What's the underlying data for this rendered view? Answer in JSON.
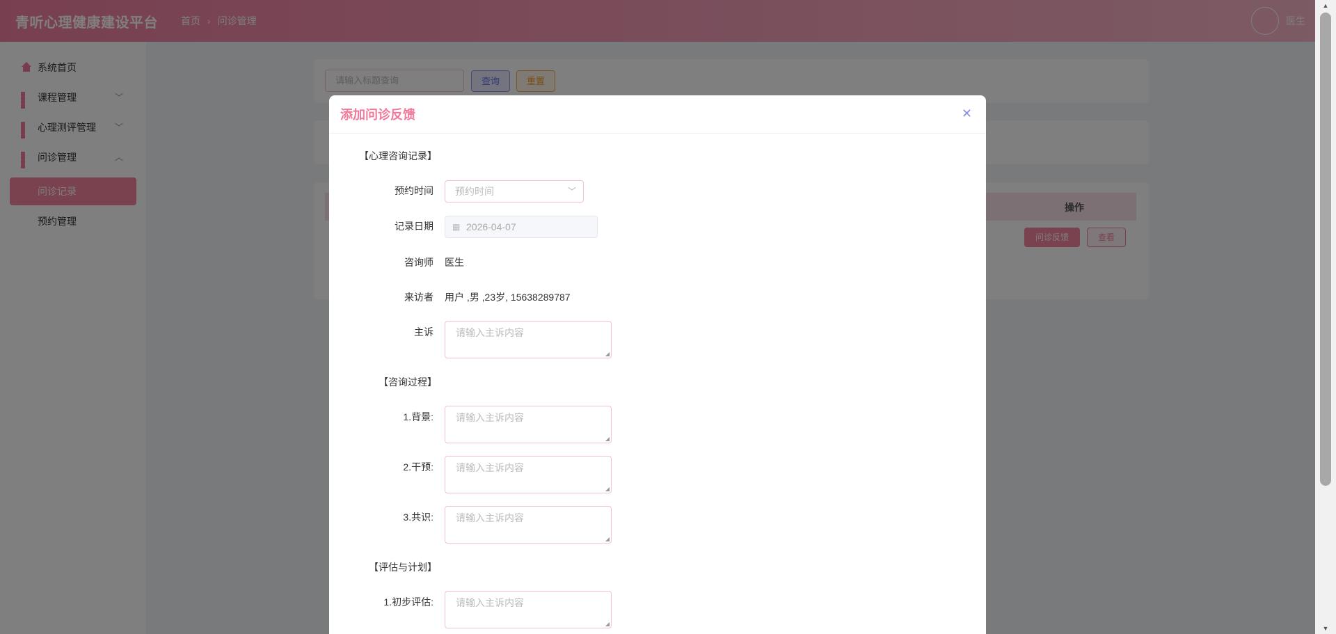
{
  "header": {
    "brand": "青听心理健康建设平台",
    "breadcrumb": [
      "首页",
      "问诊管理"
    ],
    "user_name": "医生"
  },
  "sidebar": {
    "items": [
      {
        "label": "系统首页",
        "icon": "home-icon"
      },
      {
        "label": "课程管理",
        "icon": "grid-icon",
        "chevron": "﹀"
      },
      {
        "label": "心理测评管理",
        "icon": "grid-icon",
        "chevron": "﹀"
      },
      {
        "label": "问诊管理",
        "icon": "grid-icon",
        "chevron": "︿"
      }
    ],
    "sub_items": [
      {
        "label": "问诊记录",
        "active": true
      },
      {
        "label": "预约管理",
        "active": false
      }
    ]
  },
  "main": {
    "search_placeholder": "请输入标题查询",
    "query_label": "查询",
    "reset_label": "重置",
    "table_ops_header": "操作",
    "row_feedback_label": "问诊反馈",
    "row_view_label": "查看"
  },
  "modal": {
    "title": "添加问诊反馈",
    "sections": {
      "record": "【心理咨询记录】",
      "process": "【咨询过程】",
      "assessment": "【评估与计划】"
    },
    "fields": {
      "appointment_time": {
        "label": "预约时间",
        "placeholder": "预约时间"
      },
      "record_date": {
        "label": "记录日期",
        "value": "2026-04-07"
      },
      "counselor": {
        "label": "咨询师",
        "value": "医生"
      },
      "visitor": {
        "label": "来访者",
        "value": "用户 ,男 ,23岁, 15638289787"
      },
      "complaint": {
        "label": "主诉",
        "placeholder": "请输入主诉内容"
      },
      "background": {
        "label": "1.背景:",
        "placeholder": "请输入主诉内容"
      },
      "intervention": {
        "label": "2.干预:",
        "placeholder": "请输入主诉内容"
      },
      "consensus": {
        "label": "3.共识:",
        "placeholder": "请输入主诉内容"
      },
      "initial_assessment": {
        "label": "1.初步评估:",
        "placeholder": "请输入主诉内容"
      }
    }
  },
  "colors": {
    "accent": "#f4839f",
    "header_gradient_start": "#f07fa0",
    "query_button": "#6a6de8",
    "reset_button": "#f39a2d"
  }
}
